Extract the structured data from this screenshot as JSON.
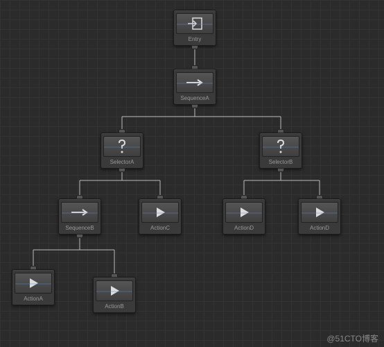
{
  "diagram": {
    "type": "behavior-tree",
    "nodes": {
      "entry": {
        "label": "Entry",
        "icon": "entry"
      },
      "sequenceA": {
        "label": "SequenceA",
        "icon": "arrow"
      },
      "selectorA": {
        "label": "SelectorA",
        "icon": "question"
      },
      "selectorB": {
        "label": "SelectorB",
        "icon": "question"
      },
      "sequenceB": {
        "label": "SequenceB",
        "icon": "arrow"
      },
      "actionC": {
        "label": "ActionC",
        "icon": "play"
      },
      "actionD1": {
        "label": "ActionD",
        "icon": "play"
      },
      "actionD2": {
        "label": "ActionD",
        "icon": "play"
      },
      "actionA": {
        "label": "ActionA",
        "icon": "play"
      },
      "actionB": {
        "label": "ActionB",
        "icon": "play"
      }
    },
    "edges": [
      [
        "entry",
        "sequenceA"
      ],
      [
        "sequenceA",
        "selectorA"
      ],
      [
        "sequenceA",
        "selectorB"
      ],
      [
        "selectorA",
        "sequenceB"
      ],
      [
        "selectorA",
        "actionC"
      ],
      [
        "selectorB",
        "actionD1"
      ],
      [
        "selectorB",
        "actionD2"
      ],
      [
        "sequenceB",
        "actionA"
      ],
      [
        "sequenceB",
        "actionB"
      ]
    ]
  },
  "watermark": "@51CTO博客"
}
